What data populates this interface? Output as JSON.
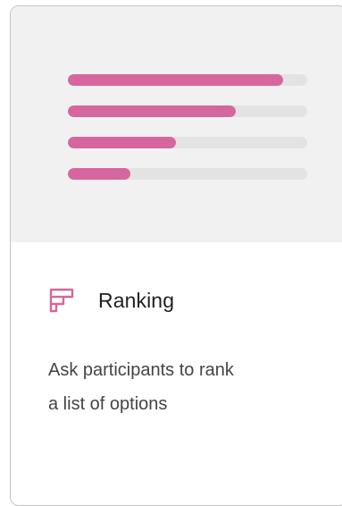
{
  "card": {
    "title": "Ranking",
    "description_line1": "Ask participants to rank",
    "description_line2": "a list of options",
    "icon": "ranking-icon",
    "accent_color": "#d6669e",
    "preview_bars": [
      {
        "fill_fraction": 0.9
      },
      {
        "fill_fraction": 0.7
      },
      {
        "fill_fraction": 0.45
      },
      {
        "fill_fraction": 0.26
      }
    ]
  }
}
